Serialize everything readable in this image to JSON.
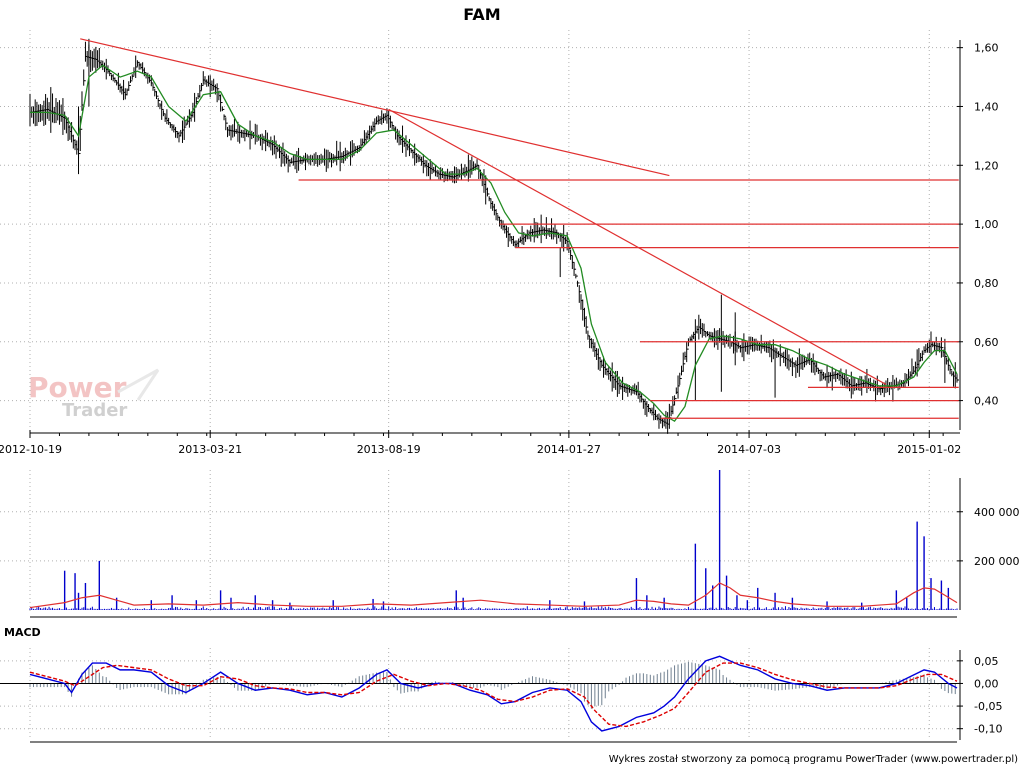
{
  "chart_data": [
    {
      "type": "line",
      "panel": "price",
      "title": "FAM",
      "ylim": [
        0.3,
        1.66
      ],
      "y_ticks": [
        "1,60",
        "1,40",
        "1,20",
        "1,00",
        "0,80",
        "0,60",
        "0,40"
      ],
      "y_tick_values": [
        1.6,
        1.4,
        1.2,
        1.0,
        0.8,
        0.6,
        0.4
      ],
      "x_ticks": [
        "2012-10-19",
        "2013-03-21",
        "2013-08-19",
        "2014-01-27",
        "2014-07-03",
        "2015-01-02"
      ],
      "x_tick_index": [
        0,
        104,
        207,
        311,
        415,
        519
      ],
      "x_count": 536,
      "grid": true,
      "price_series": {
        "name": "close",
        "color": "#000000",
        "x": [
          0,
          10,
          20,
          28,
          32,
          38,
          45,
          55,
          62,
          70,
          78,
          86,
          94,
          100,
          108,
          114,
          122,
          130,
          140,
          150,
          160,
          170,
          180,
          190,
          200,
          206,
          212,
          220,
          228,
          236,
          244,
          252,
          258,
          266,
          272,
          280,
          288,
          296,
          304,
          310,
          316,
          322,
          330,
          340,
          350,
          356,
          362,
          368,
          374,
          380,
          386,
          392,
          398,
          404,
          410,
          418,
          426,
          434,
          442,
          450,
          458,
          466,
          474,
          482,
          490,
          498,
          504,
          510,
          516,
          520,
          526,
          532,
          535
        ],
        "y": [
          1.38,
          1.39,
          1.36,
          1.24,
          1.57,
          1.56,
          1.52,
          1.44,
          1.55,
          1.48,
          1.36,
          1.3,
          1.38,
          1.49,
          1.46,
          1.32,
          1.31,
          1.3,
          1.27,
          1.21,
          1.22,
          1.22,
          1.23,
          1.26,
          1.35,
          1.37,
          1.3,
          1.25,
          1.2,
          1.17,
          1.16,
          1.18,
          1.2,
          1.07,
          1.0,
          0.93,
          0.97,
          0.98,
          0.97,
          0.94,
          0.8,
          0.62,
          0.52,
          0.45,
          0.43,
          0.38,
          0.34,
          0.32,
          0.45,
          0.6,
          0.65,
          0.62,
          0.61,
          0.6,
          0.58,
          0.59,
          0.58,
          0.55,
          0.52,
          0.54,
          0.48,
          0.49,
          0.45,
          0.46,
          0.44,
          0.45,
          0.46,
          0.5,
          0.57,
          0.59,
          0.58,
          0.49,
          0.47
        ]
      },
      "moving_average": {
        "color": "#228b22",
        "x": [
          0,
          10,
          20,
          28,
          34,
          42,
          52,
          62,
          70,
          80,
          90,
          100,
          110,
          120,
          130,
          140,
          150,
          160,
          170,
          180,
          190,
          200,
          210,
          220,
          230,
          240,
          250,
          258,
          266,
          274,
          282,
          290,
          300,
          310,
          318,
          324,
          332,
          342,
          352,
          360,
          366,
          372,
          378,
          384,
          392,
          400,
          410,
          420,
          430,
          440,
          450,
          460,
          470,
          480,
          490,
          500,
          510,
          516,
          522,
          528,
          535
        ],
        "y": [
          1.38,
          1.38,
          1.37,
          1.3,
          1.5,
          1.54,
          1.5,
          1.52,
          1.5,
          1.4,
          1.35,
          1.44,
          1.45,
          1.34,
          1.3,
          1.28,
          1.24,
          1.22,
          1.22,
          1.22,
          1.25,
          1.31,
          1.32,
          1.27,
          1.22,
          1.17,
          1.17,
          1.19,
          1.14,
          1.04,
          0.97,
          0.96,
          0.97,
          0.96,
          0.85,
          0.66,
          0.53,
          0.46,
          0.43,
          0.39,
          0.35,
          0.33,
          0.38,
          0.52,
          0.61,
          0.62,
          0.61,
          0.59,
          0.59,
          0.57,
          0.54,
          0.52,
          0.49,
          0.47,
          0.45,
          0.45,
          0.48,
          0.53,
          0.57,
          0.57,
          0.49
        ]
      },
      "annotations": {
        "color": "#e03030",
        "trendlines": [
          {
            "x1": 29,
            "y1": 1.63,
            "x2": 369,
            "y2": 1.165
          },
          {
            "x1": 207,
            "y1": 1.39,
            "x2": 494,
            "y2": 0.455
          }
        ],
        "hlines": [
          {
            "x1": 155,
            "x2": 536,
            "y": 1.15
          },
          {
            "x1": 271,
            "x2": 536,
            "y": 1.0
          },
          {
            "x1": 280,
            "x2": 536,
            "y": 0.92
          },
          {
            "x1": 352,
            "x2": 536,
            "y": 0.6
          },
          {
            "x1": 449,
            "x2": 536,
            "y": 0.445
          },
          {
            "x1": 358,
            "x2": 536,
            "y": 0.4
          },
          {
            "x1": 364,
            "x2": 536,
            "y": 0.34
          }
        ]
      }
    },
    {
      "type": "bar",
      "panel": "volume",
      "ylim": [
        0,
        570000
      ],
      "y_ticks": [
        "400 000",
        "200 000"
      ],
      "y_tick_values": [
        400000,
        200000
      ],
      "bar_color": "#0000cc",
      "ma_color": "#e03030",
      "spikes": [
        {
          "x": 20,
          "v": 160000
        },
        {
          "x": 26,
          "v": 150000
        },
        {
          "x": 32,
          "v": 110000
        },
        {
          "x": 40,
          "v": 200000
        },
        {
          "x": 28,
          "v": 70000
        },
        {
          "x": 50,
          "v": 50000
        },
        {
          "x": 70,
          "v": 40000
        },
        {
          "x": 82,
          "v": 60000
        },
        {
          "x": 96,
          "v": 40000
        },
        {
          "x": 110,
          "v": 80000
        },
        {
          "x": 116,
          "v": 50000
        },
        {
          "x": 130,
          "v": 60000
        },
        {
          "x": 140,
          "v": 40000
        },
        {
          "x": 150,
          "v": 30000
        },
        {
          "x": 175,
          "v": 40000
        },
        {
          "x": 198,
          "v": 45000
        },
        {
          "x": 204,
          "v": 35000
        },
        {
          "x": 246,
          "v": 80000
        },
        {
          "x": 250,
          "v": 50000
        },
        {
          "x": 300,
          "v": 40000
        },
        {
          "x": 320,
          "v": 35000
        },
        {
          "x": 350,
          "v": 130000
        },
        {
          "x": 356,
          "v": 60000
        },
        {
          "x": 366,
          "v": 50000
        },
        {
          "x": 384,
          "v": 270000
        },
        {
          "x": 390,
          "v": 170000
        },
        {
          "x": 394,
          "v": 100000
        },
        {
          "x": 398,
          "v": 570000
        },
        {
          "x": 402,
          "v": 140000
        },
        {
          "x": 408,
          "v": 60000
        },
        {
          "x": 414,
          "v": 40000
        },
        {
          "x": 420,
          "v": 90000
        },
        {
          "x": 430,
          "v": 70000
        },
        {
          "x": 440,
          "v": 50000
        },
        {
          "x": 460,
          "v": 35000
        },
        {
          "x": 480,
          "v": 30000
        },
        {
          "x": 500,
          "v": 80000
        },
        {
          "x": 506,
          "v": 50000
        },
        {
          "x": 512,
          "v": 360000
        },
        {
          "x": 516,
          "v": 300000
        },
        {
          "x": 520,
          "v": 130000
        },
        {
          "x": 526,
          "v": 120000
        },
        {
          "x": 530,
          "v": 90000
        }
      ],
      "ma": {
        "x": [
          0,
          20,
          30,
          40,
          50,
          60,
          80,
          100,
          120,
          140,
          160,
          180,
          200,
          220,
          240,
          260,
          280,
          300,
          320,
          340,
          350,
          360,
          370,
          380,
          390,
          398,
          404,
          410,
          420,
          430,
          440,
          460,
          480,
          500,
          510,
          516,
          522,
          528,
          535
        ],
        "v": [
          10000,
          30000,
          50000,
          60000,
          40000,
          20000,
          25000,
          20000,
          30000,
          20000,
          15000,
          15000,
          25000,
          20000,
          30000,
          40000,
          25000,
          20000,
          15000,
          20000,
          40000,
          35000,
          25000,
          20000,
          60000,
          110000,
          90000,
          60000,
          50000,
          35000,
          25000,
          15000,
          15000,
          25000,
          70000,
          90000,
          85000,
          60000,
          30000
        ]
      }
    },
    {
      "type": "line",
      "panel": "macd",
      "title": "MACD",
      "ylim": [
        -0.125,
        0.085
      ],
      "y_ticks": [
        "0,05",
        "0,00",
        "-0,05",
        "-0,10"
      ],
      "y_tick_values": [
        0.05,
        0.0,
        -0.05,
        -0.1
      ],
      "series": [
        {
          "color": "#0000dd",
          "x": [
            0,
            10,
            20,
            24,
            30,
            36,
            44,
            52,
            60,
            70,
            80,
            90,
            100,
            110,
            120,
            130,
            140,
            150,
            160,
            170,
            180,
            190,
            200,
            206,
            214,
            224,
            234,
            244,
            254,
            264,
            272,
            280,
            290,
            300,
            310,
            318,
            324,
            330,
            340,
            350,
            360,
            366,
            372,
            380,
            390,
            398,
            404,
            410,
            420,
            430,
            440,
            450,
            460,
            470,
            480,
            490,
            500,
            508,
            516,
            522,
            530,
            535
          ],
          "y": [
            0.02,
            0.01,
            0.0,
            -0.02,
            0.02,
            0.045,
            0.045,
            0.03,
            0.03,
            0.025,
            -0.005,
            -0.02,
            0.0,
            0.025,
            0.0,
            -0.015,
            -0.01,
            -0.015,
            -0.025,
            -0.02,
            -0.03,
            -0.01,
            0.02,
            0.03,
            0.0,
            -0.01,
            0.0,
            0.0,
            -0.015,
            -0.025,
            -0.045,
            -0.04,
            -0.02,
            -0.01,
            -0.015,
            -0.04,
            -0.085,
            -0.105,
            -0.095,
            -0.075,
            -0.065,
            -0.05,
            -0.03,
            0.01,
            0.05,
            0.06,
            0.05,
            0.04,
            0.03,
            0.01,
            0.0,
            -0.005,
            -0.015,
            -0.01,
            -0.01,
            -0.01,
            0.0,
            0.015,
            0.03,
            0.025,
            0.0,
            -0.01
          ]
        },
        {
          "color": "#dd0000",
          "dashed": true,
          "x": [
            0,
            10,
            20,
            26,
            34,
            42,
            50,
            60,
            70,
            80,
            90,
            100,
            110,
            120,
            130,
            140,
            150,
            160,
            170,
            180,
            190,
            200,
            210,
            220,
            230,
            240,
            250,
            260,
            270,
            280,
            290,
            300,
            310,
            320,
            326,
            334,
            344,
            354,
            364,
            372,
            380,
            390,
            400,
            410,
            420,
            430,
            440,
            450,
            460,
            470,
            480,
            490,
            500,
            510,
            518,
            526,
            535
          ],
          "y": [
            0.025,
            0.015,
            0.005,
            -0.005,
            0.015,
            0.035,
            0.04,
            0.035,
            0.03,
            0.01,
            -0.005,
            -0.005,
            0.015,
            0.01,
            -0.005,
            -0.01,
            -0.012,
            -0.02,
            -0.02,
            -0.025,
            -0.02,
            0.005,
            0.02,
            0.005,
            -0.005,
            0.0,
            -0.005,
            -0.015,
            -0.035,
            -0.04,
            -0.03,
            -0.015,
            -0.012,
            -0.03,
            -0.06,
            -0.09,
            -0.095,
            -0.085,
            -0.07,
            -0.055,
            -0.02,
            0.025,
            0.045,
            0.045,
            0.035,
            0.02,
            0.008,
            0.0,
            -0.008,
            -0.01,
            -0.01,
            -0.01,
            -0.005,
            0.01,
            0.02,
            0.02,
            0.005
          ]
        }
      ],
      "histogram_color": "#708090"
    }
  ],
  "footer": {
    "text": "Wykres został stworzony za pomocą programu PowerTrader (www.powertrader.pl)"
  },
  "watermark": {
    "line1": "Power",
    "line2": "Trader"
  }
}
